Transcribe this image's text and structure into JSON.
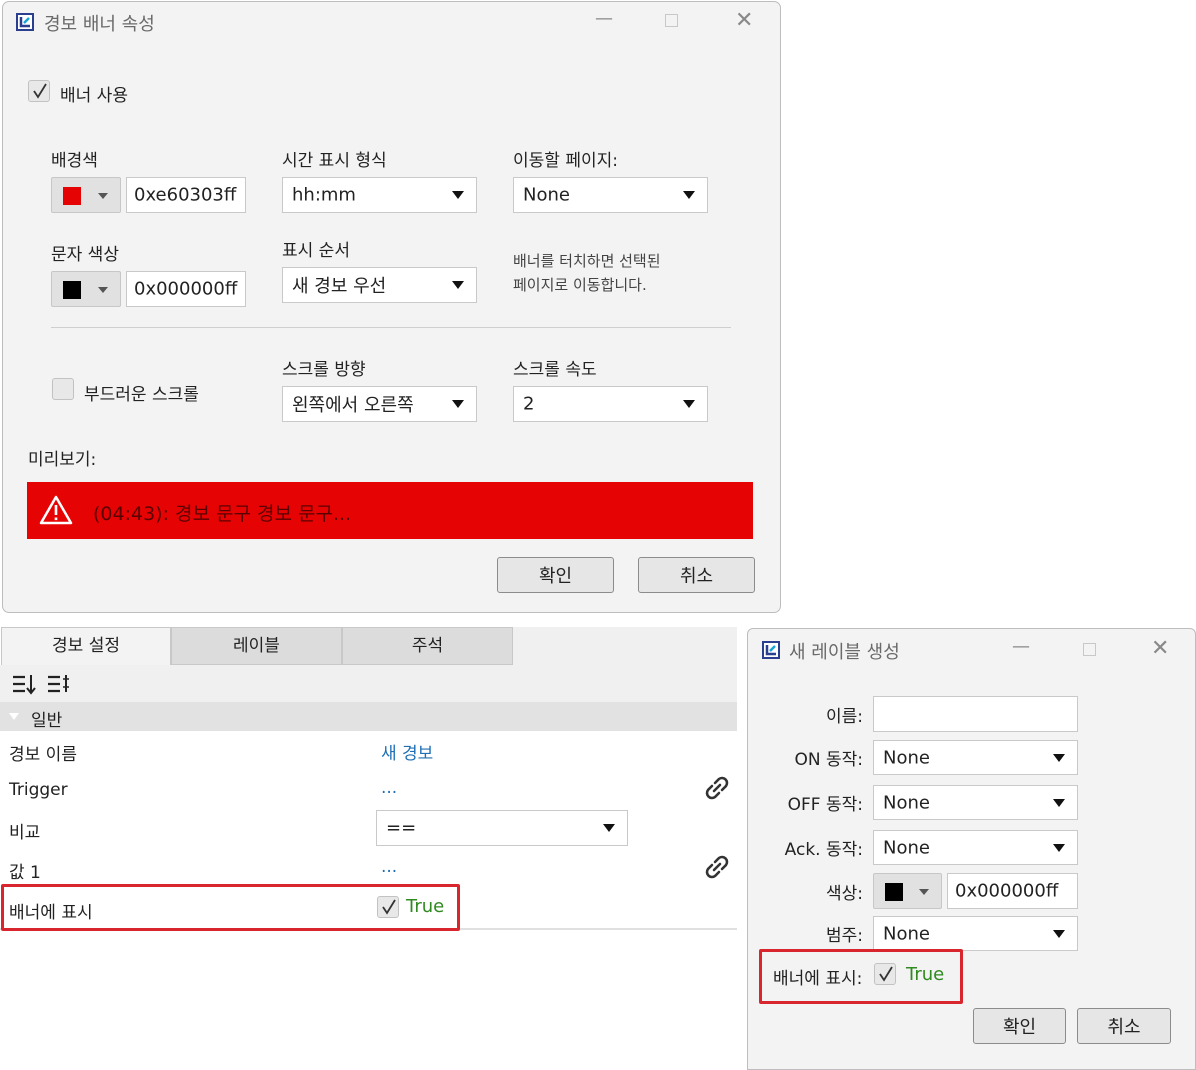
{
  "dialog1": {
    "title": "경보 배너 속성",
    "enable_label": "배너 사용",
    "bg_color_label": "배경색",
    "bg_color_value": "0xe60303ff",
    "bg_swatch": "#e60303",
    "time_format_label": "시간 표시 형식",
    "time_format_value": "hh:mm",
    "goto_page_label": "이동할 페이지:",
    "goto_page_value": "None",
    "text_color_label": "문자 색상",
    "text_color_value": "0x000000ff",
    "text_swatch": "#000000",
    "order_label": "표시 순서",
    "order_value": "새 경보 우선",
    "touch_hint_line1": "배너를 터치하면 선택된",
    "touch_hint_line2": "페이지로 이동합니다.",
    "smooth_scroll_label": "부드러운 스크롤",
    "scroll_dir_label": "스크롤 방향",
    "scroll_dir_value": "왼쪽에서 오른쪽",
    "scroll_speed_label": "스크롤 속도",
    "scroll_speed_value": "2",
    "preview_label": "미리보기:",
    "preview_text": "(04:43): 경보 문구 경보 문구...",
    "preview_bg": "#e60303",
    "ok_label": "확인",
    "cancel_label": "취소"
  },
  "panel": {
    "tabs": [
      "경보 설정",
      "레이블",
      "주석"
    ],
    "section": "일반",
    "rows": [
      {
        "name": "경보 이름",
        "value": "새 경보"
      },
      {
        "name": "Trigger",
        "value": "..."
      },
      {
        "name": "비교",
        "value": "=="
      },
      {
        "name": "값 1",
        "value": "..."
      },
      {
        "name": "배너에 표시",
        "value": "True"
      }
    ]
  },
  "dialog2": {
    "title": "새 레이블 생성",
    "name_label": "이름:",
    "name_value": "",
    "on_label": "ON 동작:",
    "on_value": "None",
    "off_label": "OFF 동작:",
    "off_value": "None",
    "ack_label": "Ack. 동작:",
    "ack_value": "None",
    "color_label": "색상:",
    "color_value": "0x000000ff",
    "color_swatch": "#000000",
    "category_label": "범주:",
    "category_value": "None",
    "banner_label": "배너에 표시:",
    "banner_value": "True",
    "ok_label": "확인",
    "cancel_label": "취소"
  },
  "colors": {
    "accent_link": "#1f6fb5",
    "true_green": "#2f8a1f",
    "highlight_red": "#d9262e"
  }
}
